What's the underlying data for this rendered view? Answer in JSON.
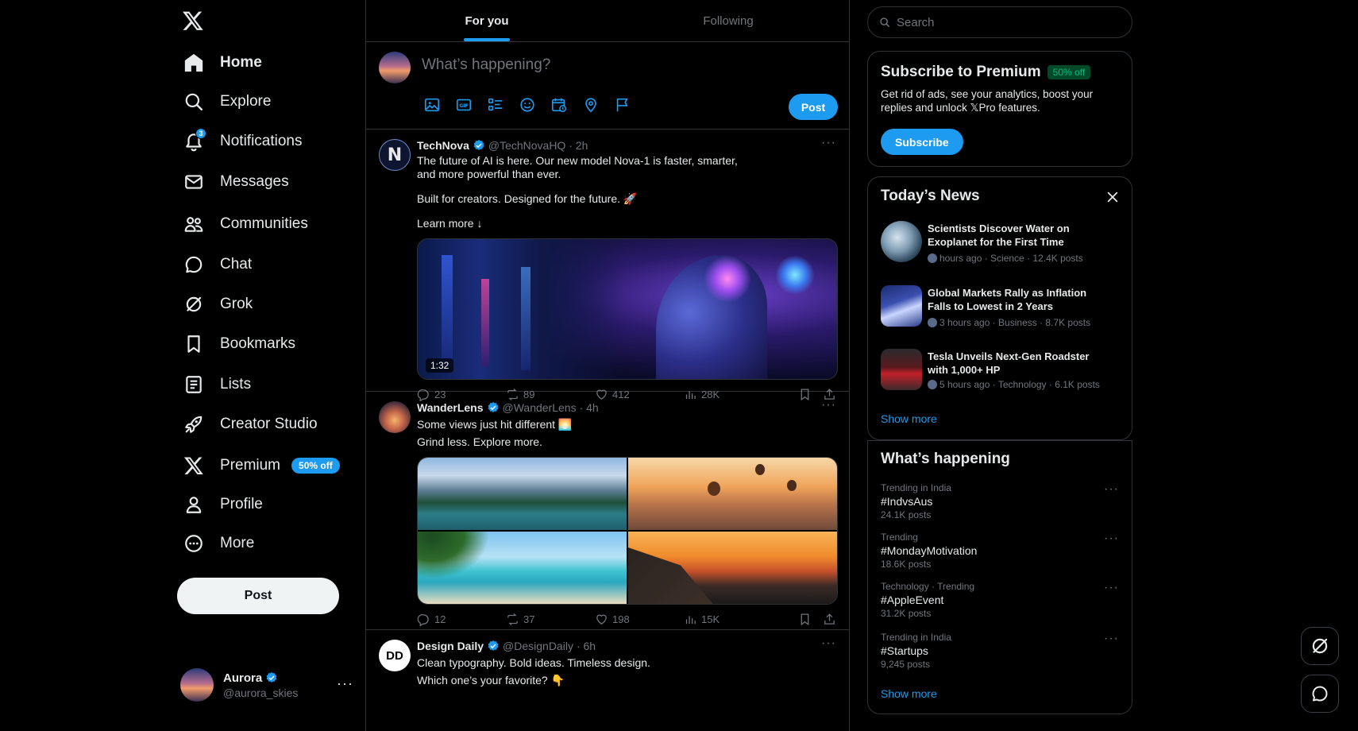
{
  "nav": {
    "items": [
      {
        "label": "Home",
        "icon": "home-icon"
      },
      {
        "label": "Explore",
        "icon": "search-icon"
      },
      {
        "label": "Notifications",
        "icon": "bell-icon",
        "badge": "3"
      },
      {
        "label": "Messages",
        "icon": "mail-icon"
      },
      {
        "label": "Communities",
        "icon": "people-icon"
      },
      {
        "label": "Chat",
        "icon": "chat-icon"
      },
      {
        "label": "Grok",
        "icon": "grok-icon"
      },
      {
        "label": "Bookmarks",
        "icon": "bookmark-icon"
      },
      {
        "label": "Lists",
        "icon": "list-icon"
      },
      {
        "label": "Creator Studio",
        "icon": "rocket-icon"
      },
      {
        "label": "Premium",
        "icon": "x-logo-icon",
        "pill": "50% off"
      },
      {
        "label": "Profile",
        "icon": "person-icon"
      },
      {
        "label": "More",
        "icon": "more-circle-icon"
      }
    ],
    "post_label": "Post",
    "account": {
      "name": "Aurora",
      "handle": "@aurora_skies"
    }
  },
  "tabs": [
    {
      "label": "For you"
    },
    {
      "label": "Following"
    }
  ],
  "compose": {
    "placeholder": "What’s happening?",
    "post_label": "Post"
  },
  "tweets": [
    {
      "name": "TechNova",
      "handle": "@TechNovaHQ",
      "time": "· 2h",
      "text1": "The future of AI is here. Our new model Nova-1 is faster, smarter, and more powerful than ever.",
      "text2": "Built for creators. Designed for the future. 🚀",
      "text3": "Learn more ↓",
      "duration": "1:32",
      "replies": "23",
      "reposts": "89",
      "likes": "412",
      "views": "28K"
    },
    {
      "name": "WanderLens",
      "handle": "@WanderLens",
      "time": "· 4h",
      "text1": "Some views just hit different 🌅",
      "text2": "Grind less. Explore more.",
      "replies": "12",
      "reposts": "37",
      "likes": "198",
      "views": "15K"
    },
    {
      "name": "Design Daily",
      "handle": "@DesignDaily",
      "time": "· 6h",
      "avatar_text": "DD",
      "text1": "Clean typography. Bold ideas. Timeless design.",
      "text2": "Which one’s your favorite? 👇"
    }
  ],
  "search": {
    "placeholder": "Search"
  },
  "premium": {
    "title": "Subscribe to Premium",
    "pill": "50% off",
    "desc": "Get rid of ads, see your analytics, boost your replies and unlock 𝕏Pro features.",
    "button": "Subscribe"
  },
  "news": {
    "title": "Today’s News",
    "items": [
      {
        "title": "Scientists Discover Water on Exoplanet for the First Time",
        "meta": "hours ago · Science · 12.4K posts"
      },
      {
        "title": "Global Markets Rally as Inflation Falls to Lowest in 2 Years",
        "meta": "3 hours ago · Business · 8.7K posts"
      },
      {
        "title": "Tesla Unveils Next-Gen Roadster with 1,000+ HP",
        "meta": "5 hours ago · Technology · 6.1K posts"
      }
    ],
    "show_more": "Show more"
  },
  "happening": {
    "title": "What’s happening",
    "items": [
      {
        "context": "Trending in India",
        "tag": "#IndvsAus",
        "count": "24.1K posts"
      },
      {
        "context": "Trending",
        "tag": "#MondayMotivation",
        "count": "18.6K posts"
      },
      {
        "context": "Technology · Trending",
        "tag": "#AppleEvent",
        "count": "31.2K posts"
      },
      {
        "context": "Trending in India",
        "tag": "#Startups",
        "count": "9,245 posts"
      }
    ],
    "show_more": "Show more"
  },
  "colors": {
    "accent": "#1d9bf0",
    "background": "#000000",
    "border": "#2f3336",
    "muted": "#71767b",
    "text": "#e7e9ea"
  }
}
